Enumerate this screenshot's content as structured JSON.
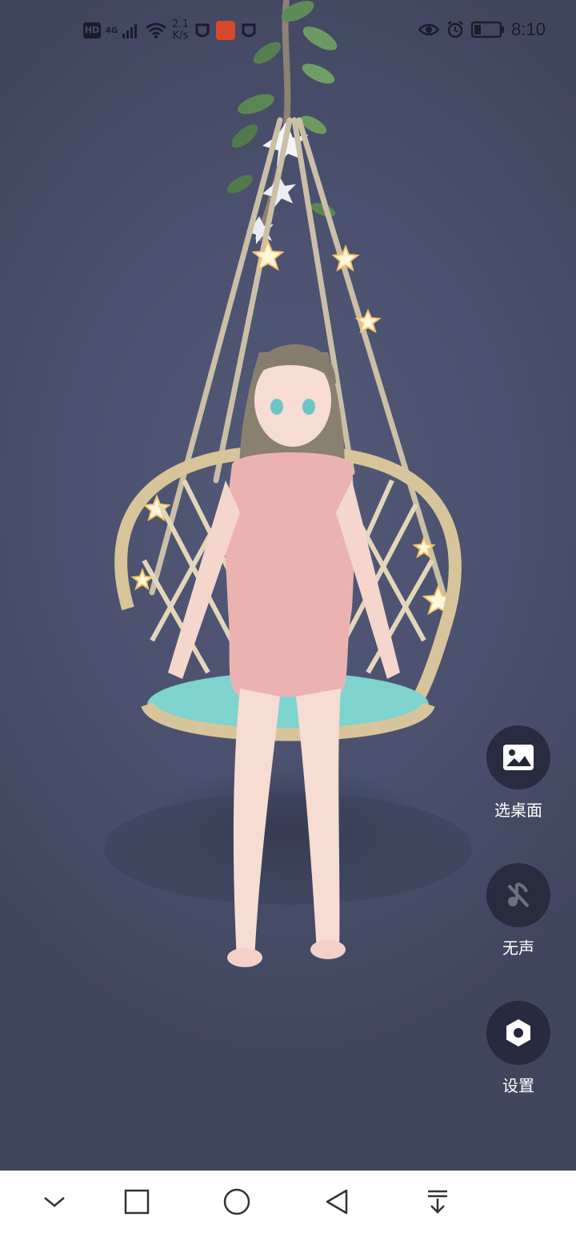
{
  "status_bar": {
    "hd_label": "HD",
    "network_label": "4G",
    "speed_value": "2.1",
    "speed_unit": "K/s",
    "time": "8:10"
  },
  "actions": {
    "wallpaper_label": "选桌面",
    "mute_label": "无声",
    "settings_label": "设置"
  },
  "colors": {
    "background": "#474d6b",
    "nav_bar": "#ffffff",
    "action_circle": "#24273a"
  },
  "icons": {
    "status": [
      "hd-icon",
      "signal-icon",
      "wifi-icon",
      "app-icon",
      "eye-icon",
      "alarm-icon",
      "battery-icon"
    ],
    "actions": [
      "image-icon",
      "mute-icon",
      "settings-icon"
    ],
    "nav": [
      "chevron-down-icon",
      "square-icon",
      "circle-icon",
      "back-triangle-icon",
      "pull-down-icon"
    ]
  }
}
